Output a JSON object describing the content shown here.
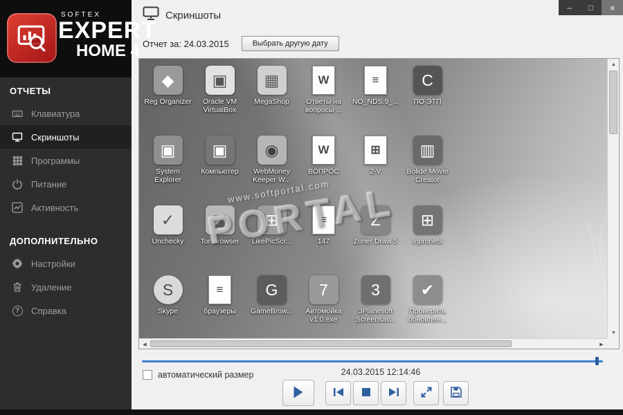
{
  "window": {
    "controls": {
      "minimize": "–",
      "maximize": "□",
      "close": "×"
    }
  },
  "header": {
    "title": "Скриншоты"
  },
  "sidebar": {
    "logo": {
      "brand": "SOFTEX",
      "product": "EXPERT",
      "edition": "HOME 4"
    },
    "sections": [
      {
        "title": "ОТЧЕТЫ",
        "items": [
          {
            "label": "Клавиатура"
          },
          {
            "label": "Скриншоты"
          },
          {
            "label": "Программы"
          },
          {
            "label": "Питание"
          },
          {
            "label": "Активность"
          }
        ]
      },
      {
        "title": "ДОПОЛНИТЕЛЬНО",
        "items": [
          {
            "label": "Настройки"
          },
          {
            "label": "Удаление"
          },
          {
            "label": "Справка"
          }
        ]
      }
    ]
  },
  "icons": {
    "help": "?"
  },
  "toolbar": {
    "report_label": "Отчет за: 24.03.2015",
    "date_button_label": "Выбрать другую дату"
  },
  "screenshot": {
    "watermark_url": "www.softportal.com",
    "watermark_text": "PORTAL",
    "icons": [
      {
        "label": "Reg Organizer",
        "kind": "app",
        "bg": "#9a9a9a",
        "glyph": "◆"
      },
      {
        "label": "Oracle VM VirtualBox",
        "kind": "app",
        "bg": "#e2e2e2",
        "fg": "#555555",
        "glyph": "▣"
      },
      {
        "label": "MegaShop",
        "kind": "app",
        "bg": "#cfcfcf",
        "fg": "#616161",
        "glyph": "▦"
      },
      {
        "label": "Ответы на вопросы ...",
        "kind": "page",
        "glyph": "W"
      },
      {
        "label": "NO_NDS.9_...",
        "kind": "page",
        "glyph": "≡"
      },
      {
        "label": "ПО ЭТП",
        "kind": "app",
        "bg": "#555555",
        "glyph": "C"
      },
      {
        "label": "System Explorer",
        "kind": "app",
        "bg": "#8f8f8f",
        "glyph": "▣"
      },
      {
        "label": "Компьютер",
        "kind": "app",
        "bg": "#767676",
        "glyph": "▣"
      },
      {
        "label": "WebMoney Keeper W...",
        "kind": "app",
        "bg": "#b5b5b5",
        "fg": "#3f3f3f",
        "glyph": "◉"
      },
      {
        "label": "ВОПРОС",
        "kind": "page",
        "glyph": "W"
      },
      {
        "label": "2-V",
        "kind": "page",
        "glyph": "⊞"
      },
      {
        "label": "Bolide Movie Creator",
        "kind": "app",
        "bg": "#6a6a6a",
        "glyph": "▥"
      },
      {
        "label": "Unchecky",
        "kind": "app",
        "bg": "#dcdcdc",
        "fg": "#525252",
        "glyph": "✓"
      },
      {
        "label": "Tor Browser",
        "kind": "app",
        "bg": "#b8b8b8",
        "fg": "#565656",
        "glyph": "◪"
      },
      {
        "label": "LikePicScr...",
        "kind": "app",
        "bg": "#9e9e9e",
        "glyph": "⊞"
      },
      {
        "label": "147",
        "kind": "page",
        "glyph": "≡"
      },
      {
        "label": "Zoner Draw 5",
        "kind": "app",
        "bg": "#868686",
        "glyph": "Z"
      },
      {
        "label": "Inpronets",
        "kind": "app",
        "bg": "#747474",
        "glyph": "⊞"
      },
      {
        "label": "Skype",
        "kind": "app",
        "bg": "#d8d8d8",
        "fg": "#4a4a4a",
        "glyph": "S",
        "round": true
      },
      {
        "label": "браузеры",
        "kind": "page",
        "glyph": "≡"
      },
      {
        "label": "GameBrow...",
        "kind": "app",
        "bg": "#5c5c5c",
        "glyph": "G"
      },
      {
        "label": "Автомойка v1.0.exe",
        "kind": "app",
        "bg": "#999999",
        "glyph": "7"
      },
      {
        "label": "3Planesoft Screensav...",
        "kind": "app",
        "bg": "#6f6f6f",
        "glyph": "3"
      },
      {
        "label": "Проверить обновлен...",
        "kind": "app",
        "bg": "#8d8d8d",
        "glyph": "✔"
      }
    ]
  },
  "player": {
    "auto_size_label": "автоматический размер",
    "timestamp": "24.03.2015 12:14:46"
  }
}
